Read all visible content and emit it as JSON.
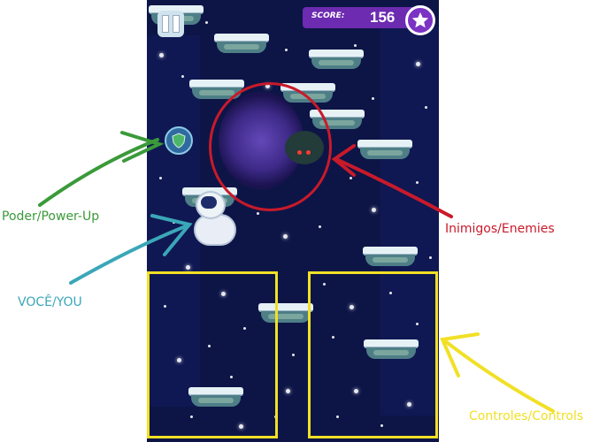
{
  "hud": {
    "score_label": "SCORE:",
    "score_value": "156",
    "pause_icon": "pause-icon",
    "star_icon": "star-icon"
  },
  "annotations": {
    "powerup": "Poder/Power-Up",
    "you": "VOCÊ/YOU",
    "enemies": "Inimigos/Enemies",
    "controls": "Controles/Controls"
  },
  "colors": {
    "powerup": "#3a9a3a",
    "you": "#3aa7b8",
    "enemies": "#c91a2a",
    "controls": "#f1e025",
    "game_bg": "#0d1547",
    "score_bar": "#6c2bb0"
  },
  "elements": {
    "powerup_icon": "shield-icon",
    "enemy_icon": "spider-enemy-icon",
    "portal_icon": "black-hole-icon",
    "player_icon": "astronaut-icon"
  }
}
